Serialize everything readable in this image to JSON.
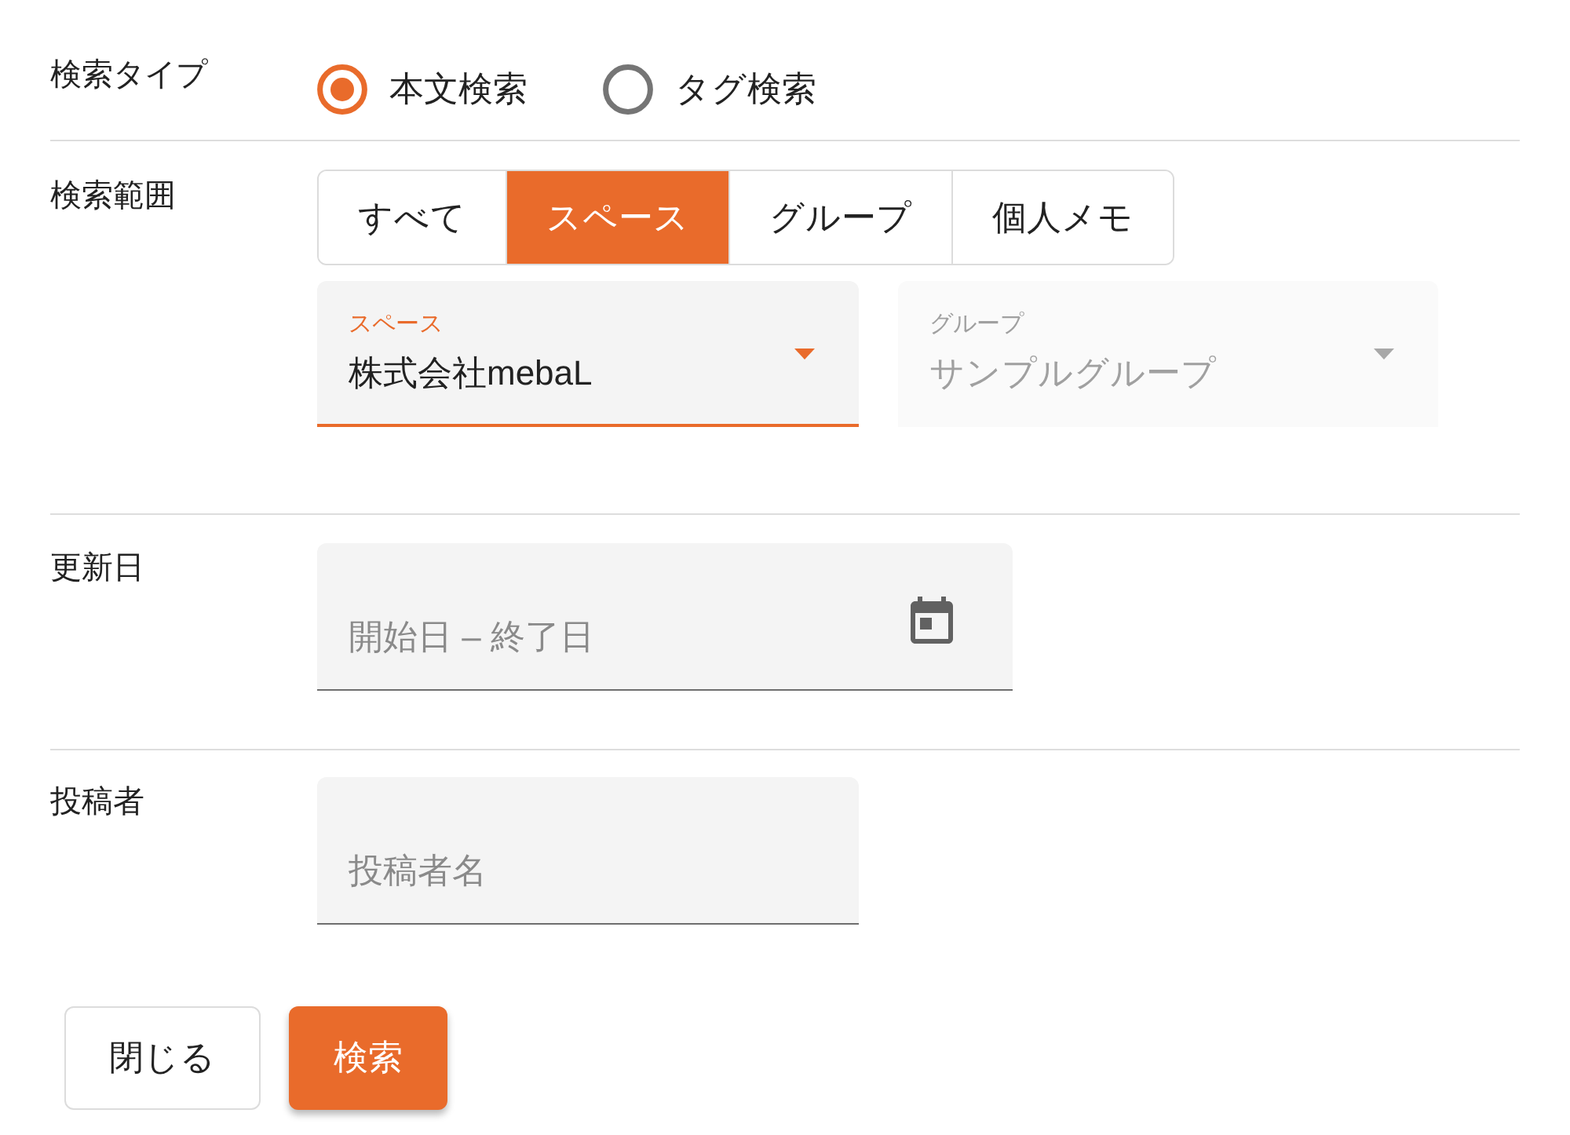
{
  "search_type": {
    "label": "検索タイプ",
    "options": [
      {
        "label": "本文検索",
        "selected": true
      },
      {
        "label": "タグ検索",
        "selected": false
      }
    ]
  },
  "search_scope": {
    "label": "検索範囲",
    "toggles": [
      {
        "label": "すべて",
        "selected": false
      },
      {
        "label": "スペース",
        "selected": true
      },
      {
        "label": "グループ",
        "selected": false
      },
      {
        "label": "個人メモ",
        "selected": false
      }
    ],
    "selects": [
      {
        "label": "スペース",
        "value": "株式会社mebaL",
        "focused": true,
        "disabled": false
      },
      {
        "label": "グループ",
        "value": "サンプルグループ",
        "focused": false,
        "disabled": true
      }
    ]
  },
  "updated_date": {
    "label": "更新日",
    "placeholder": "開始日 – 終了日"
  },
  "author": {
    "label": "投稿者",
    "placeholder": "投稿者名"
  },
  "buttons": [
    {
      "label": "閉じる",
      "kind": "close"
    },
    {
      "label": "検索",
      "kind": "search"
    }
  ]
}
